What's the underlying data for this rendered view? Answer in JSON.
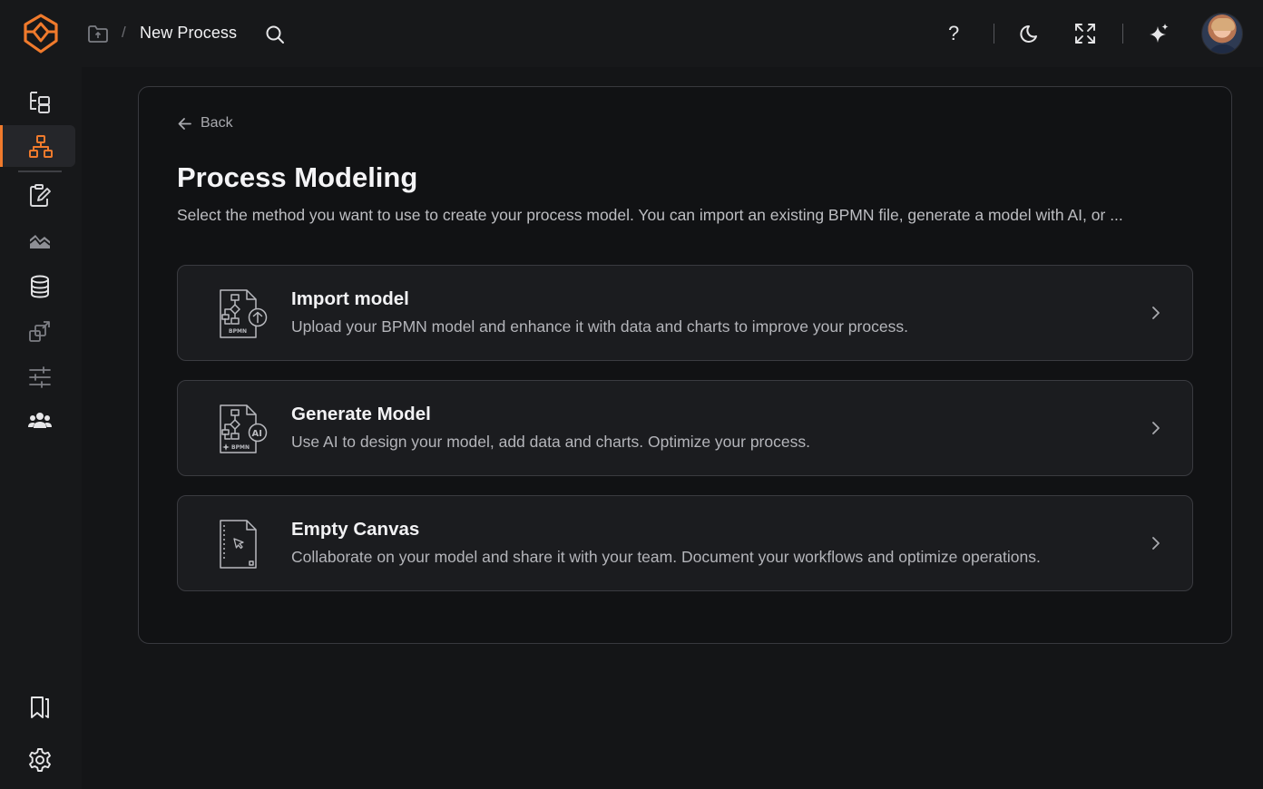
{
  "topbar": {
    "breadcrumb_separator": "/",
    "title": "New Process",
    "icons": [
      "app-logo-icon",
      "folder-icon",
      "search-icon",
      "help-icon",
      "moon-icon",
      "fullscreen-icon",
      "sparkle-icon"
    ],
    "help_label": "?"
  },
  "sidebar": {
    "items": [
      {
        "name": "tree-icon"
      },
      {
        "name": "process-hierarchy-icon",
        "active": true
      },
      {
        "name": "clipboard-edit-icon"
      },
      {
        "name": "chart-landscape-icon"
      },
      {
        "name": "database-icon"
      },
      {
        "name": "shapes-share-icon"
      },
      {
        "name": "sliders-icon"
      },
      {
        "name": "users-icon"
      }
    ],
    "bottom_items": [
      {
        "name": "bookmark-icon"
      },
      {
        "name": "settings-icon"
      }
    ]
  },
  "main": {
    "back_label": "Back",
    "title": "Process Modeling",
    "description": "Select the method you want to use to create your process model. You can import an existing BPMN file, generate a model with AI, or ...",
    "options": [
      {
        "title": "Import model",
        "description": "Upload your BPMN model and enhance it with data and charts to improve your process.",
        "icon_caption": "BPMN"
      },
      {
        "title": "Generate Model",
        "description": "Use AI to design your model, add data and charts. Optimize your process.",
        "icon_caption": "BPMN",
        "icon_badge": "AI"
      },
      {
        "title": "Empty Canvas",
        "description": "Collaborate on your model and share it with your team. Document your workflows and optimize operations."
      }
    ]
  },
  "colors": {
    "accent": "#f07a2c",
    "background": "#141517",
    "card": "#1b1c1f",
    "border": "#3a3b40"
  }
}
